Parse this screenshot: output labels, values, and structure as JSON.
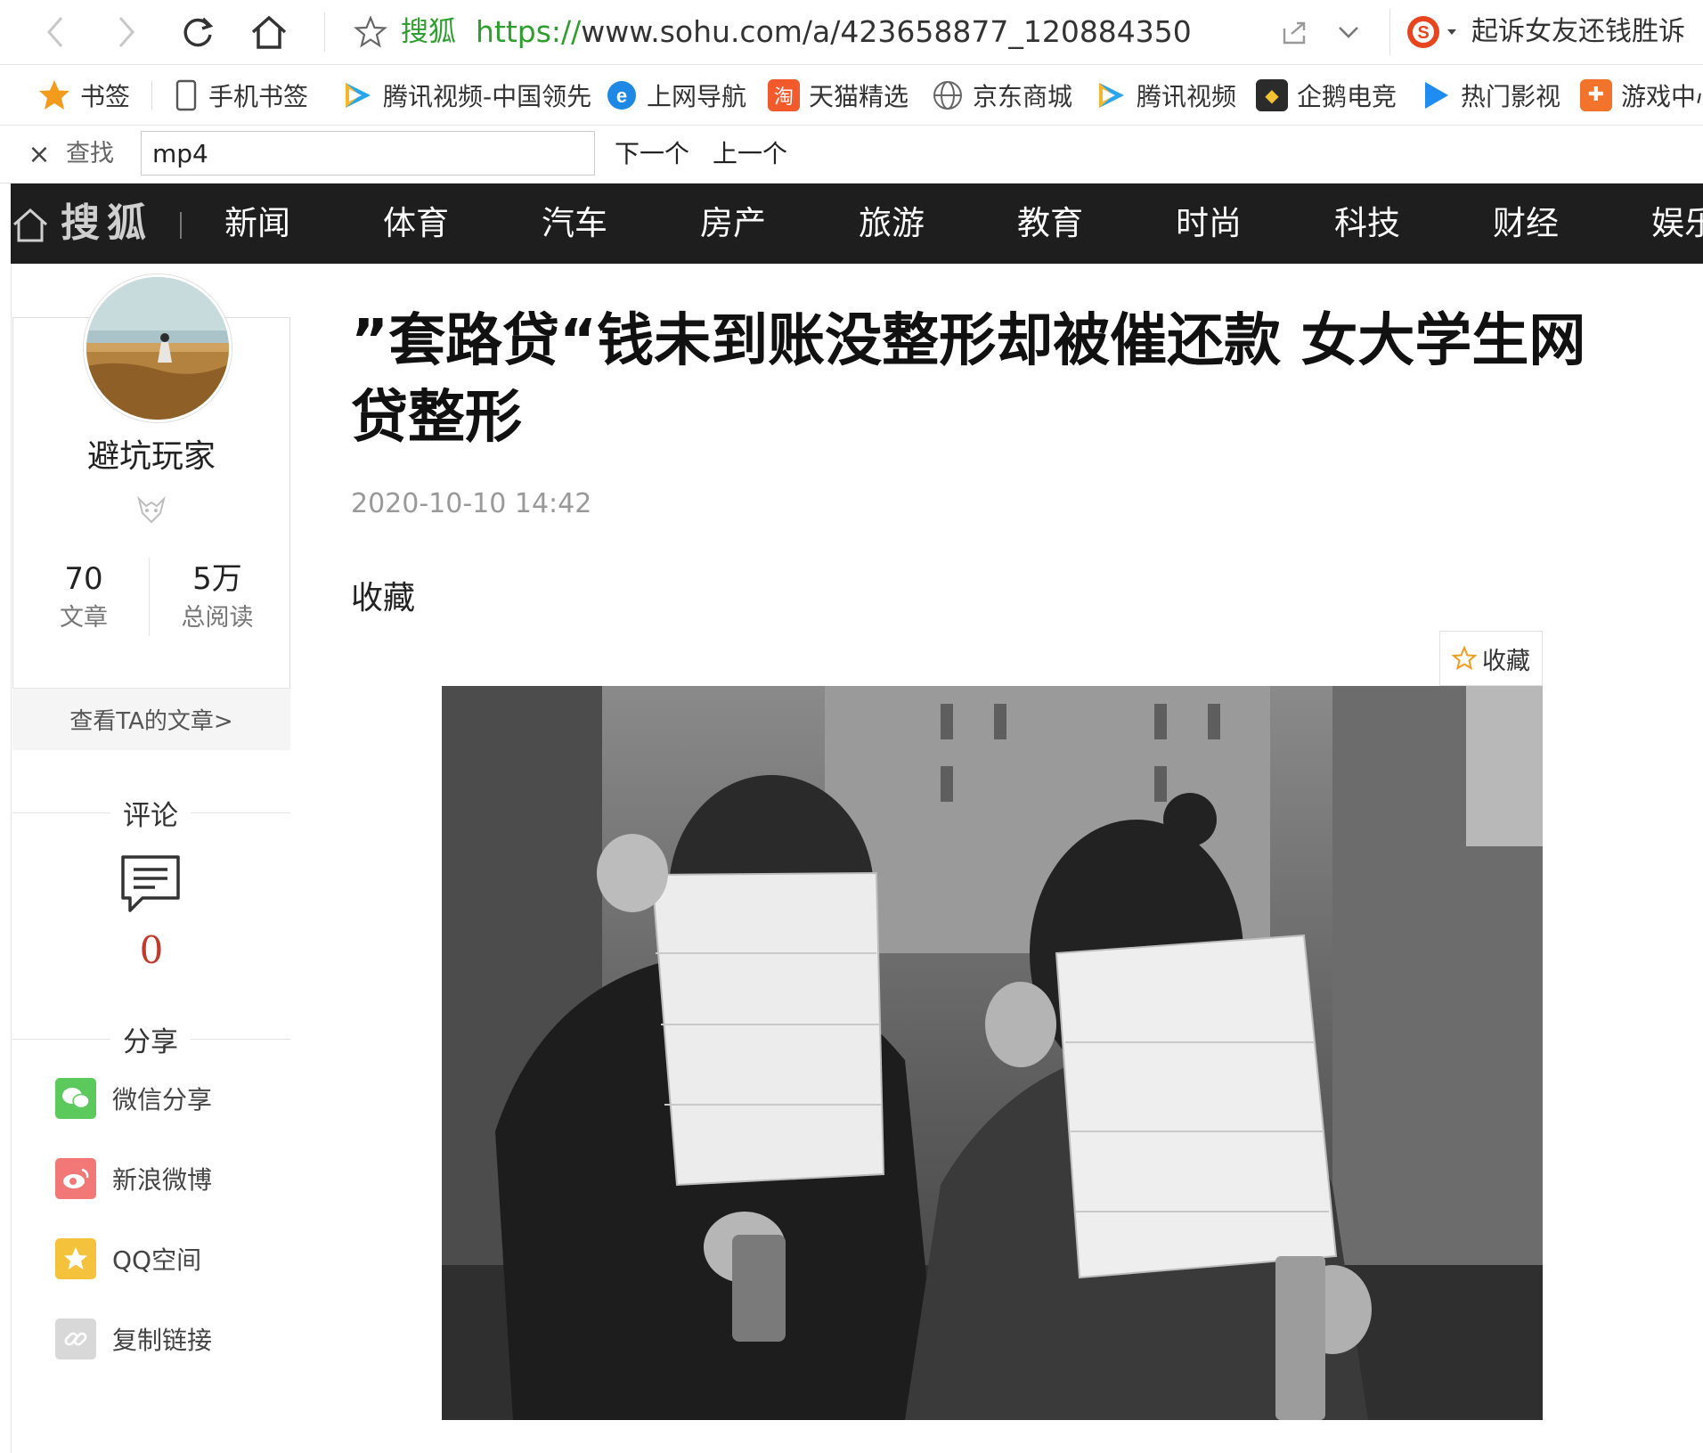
{
  "browser": {
    "site_name": "搜狐",
    "url_protocol": "https://",
    "url_rest": "www.sohu.com/a/423658877_120884350",
    "search_query": "起诉女友还钱胜诉"
  },
  "bookmarks": [
    {
      "label": "书签",
      "icon": "star-icon"
    },
    {
      "label": "手机书签",
      "icon": "phone-icon"
    },
    {
      "label": "腾讯视频-中国领先",
      "icon": "tencent-video-icon"
    },
    {
      "label": "上网导航",
      "icon": "ie-icon"
    },
    {
      "label": "天猫精选",
      "icon": "tmall-icon"
    },
    {
      "label": "京东商城",
      "icon": "globe-icon"
    },
    {
      "label": "腾讯视频",
      "icon": "tencent-video-icon"
    },
    {
      "label": "企鹅电竞",
      "icon": "esports-icon"
    },
    {
      "label": "热门影视",
      "icon": "play-icon"
    },
    {
      "label": "游戏中心",
      "icon": "gamepad-icon"
    }
  ],
  "findbar": {
    "label": "查找",
    "query": "mp4",
    "next": "下一个",
    "prev": "上一个"
  },
  "sohu_nav": {
    "logo": "搜狐",
    "items": [
      "新闻",
      "体育",
      "汽车",
      "房产",
      "旅游",
      "教育",
      "时尚",
      "科技",
      "财经",
      "娱乐"
    ]
  },
  "author": {
    "name": "避坑玩家",
    "articles_count": "70",
    "articles_label": "文章",
    "reads_count": "5万",
    "reads_label": "总阅读",
    "view_link": "查看TA的文章>"
  },
  "comments": {
    "title": "评论",
    "count": "0"
  },
  "share": {
    "title": "分享",
    "items": [
      {
        "label": "微信分享",
        "color": "#5cc95c"
      },
      {
        "label": "新浪微博",
        "color": "#f27878"
      },
      {
        "label": "QQ空间",
        "color": "#f5c33b"
      },
      {
        "label": "复制链接",
        "color": "#d8d8d8"
      }
    ]
  },
  "article": {
    "title": "”套路贷“钱未到账没整形却被催还款 女大学生网贷整形",
    "date": "2020-10-10 14:42",
    "collect_text": "收藏",
    "collect_button": "收藏"
  }
}
